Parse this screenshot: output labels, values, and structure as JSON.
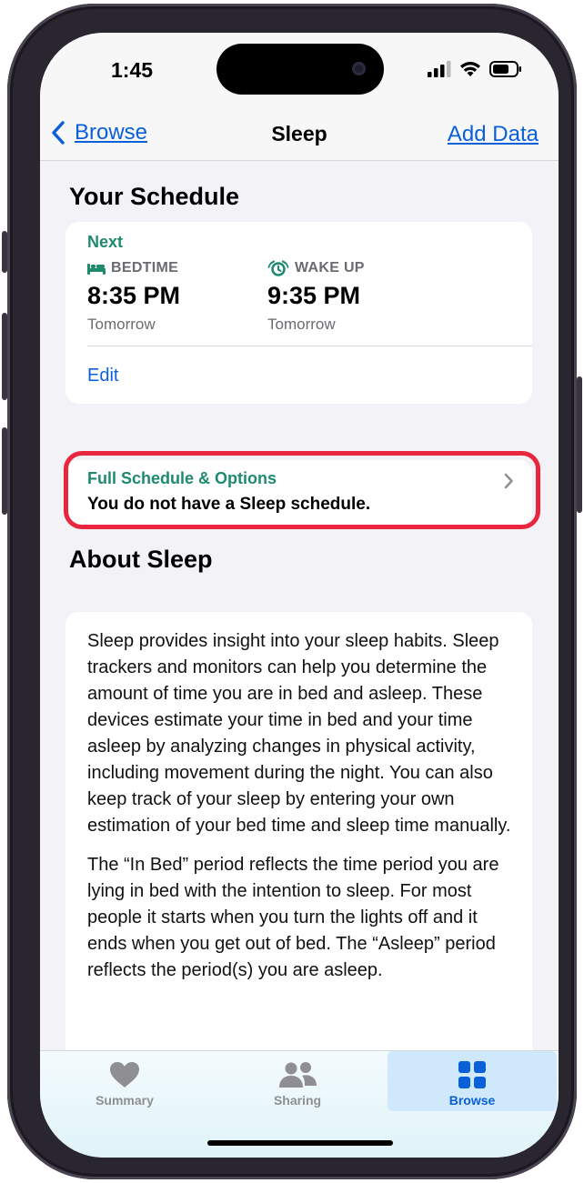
{
  "status": {
    "time": "1:45"
  },
  "nav": {
    "back_label": "Browse",
    "title": "Sleep",
    "right_label": "Add Data"
  },
  "schedule": {
    "section_title": "Your Schedule",
    "next_label": "Next",
    "bedtime": {
      "label": "BEDTIME",
      "time": "8:35 PM",
      "day": "Tomorrow"
    },
    "wakeup": {
      "label": "WAKE UP",
      "time": "9:35 PM",
      "day": "Tomorrow"
    },
    "edit_label": "Edit"
  },
  "full_schedule": {
    "title": "Full Schedule & Options",
    "subtitle": "You do not have a Sleep schedule."
  },
  "about": {
    "section_title": "About Sleep",
    "paragraphs": [
      "Sleep provides insight into your sleep habits. Sleep trackers and monitors can help you determine the amount of time you are in bed and asleep. These devices estimate your time in bed and your time asleep by analyzing changes in physical activity, including movement during the night. You can also keep track of your sleep by entering your own estimation of your bed time and sleep time manually.",
      "The “In Bed” period reflects the time period you are lying in bed with the intention to sleep. For most people it starts when you turn the lights off and it ends when you get out of bed. The “Asleep” period reflects the period(s) you are asleep."
    ]
  },
  "tabs": [
    {
      "label": "Summary",
      "icon": "heart-icon"
    },
    {
      "label": "Sharing",
      "icon": "people-icon"
    },
    {
      "label": "Browse",
      "icon": "grid-icon"
    }
  ],
  "colors": {
    "accent_blue": "#0a60d8",
    "sleep_teal": "#1e8a6e",
    "highlight_red": "#e8273e",
    "inactive_gray": "#8e8e93"
  }
}
